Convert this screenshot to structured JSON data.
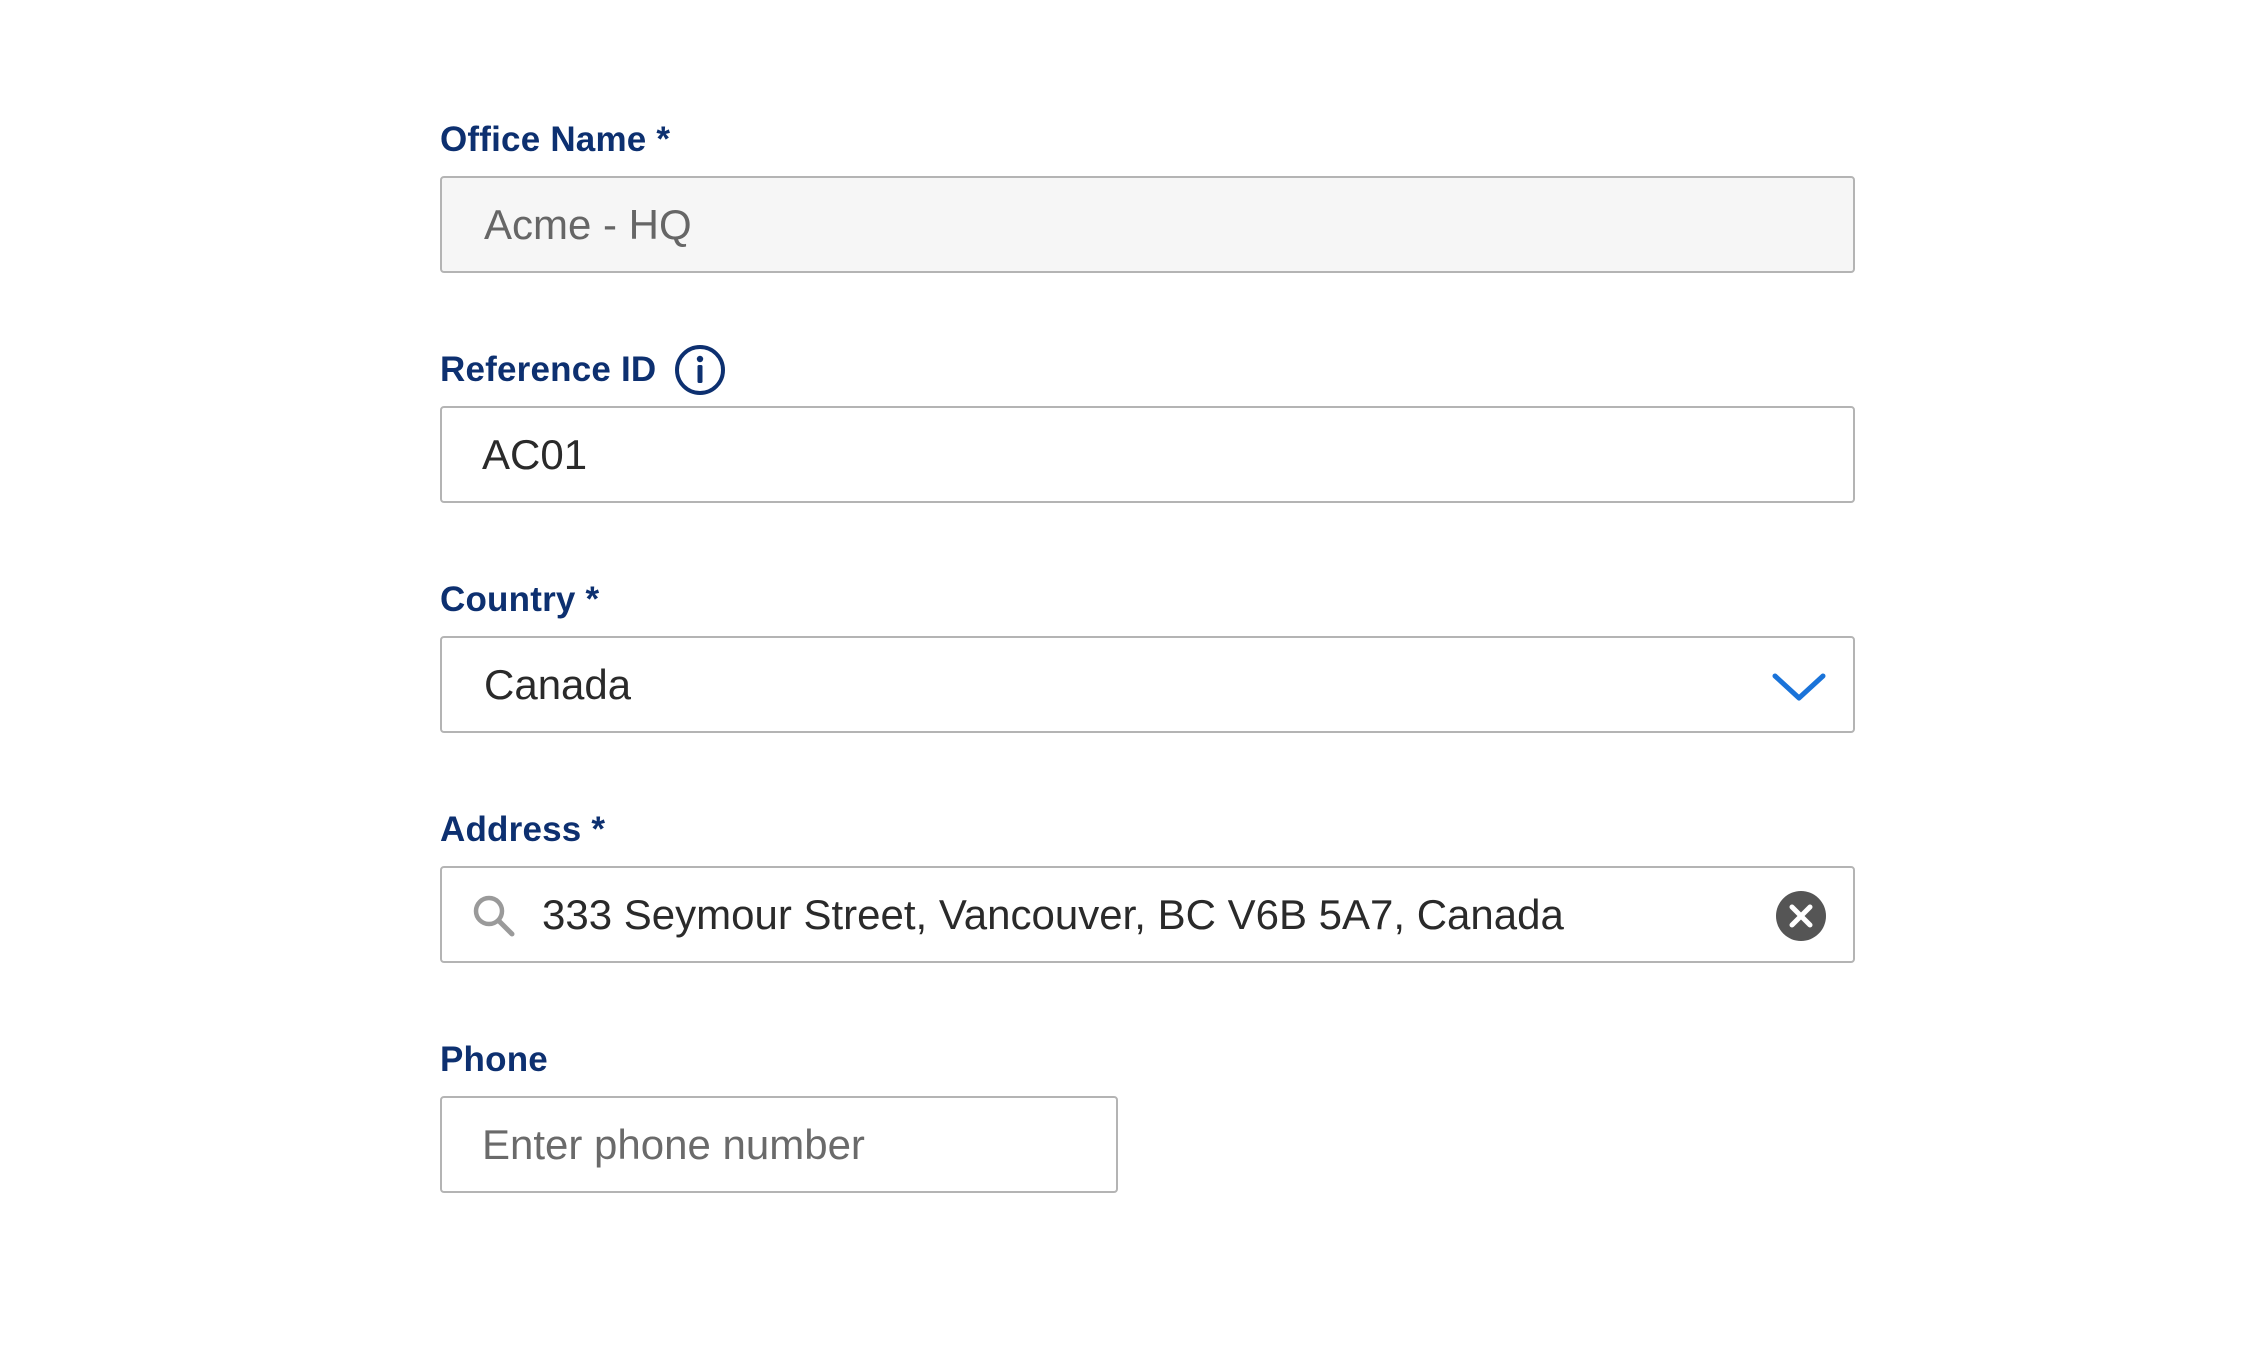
{
  "form": {
    "office_name": {
      "label": "Office Name *",
      "value": "Acme - HQ"
    },
    "reference_id": {
      "label": "Reference ID",
      "value": "AC01",
      "icon": "info-icon"
    },
    "country": {
      "label": "Country *",
      "value": "Canada",
      "icon": "chevron-down-icon"
    },
    "address": {
      "label": "Address *",
      "value": "333 Seymour Street, Vancouver, BC V6B 5A7, Canada",
      "leading_icon": "search-icon",
      "trailing_icon": "clear-icon"
    },
    "phone": {
      "label": "Phone",
      "value": "",
      "placeholder": "Enter phone number"
    }
  },
  "colors": {
    "label": "#0d3070",
    "accent": "#1a73d9",
    "border": "#b4b4b4",
    "disabled_bg": "#f6f6f6",
    "clear_icon": "#555555"
  }
}
